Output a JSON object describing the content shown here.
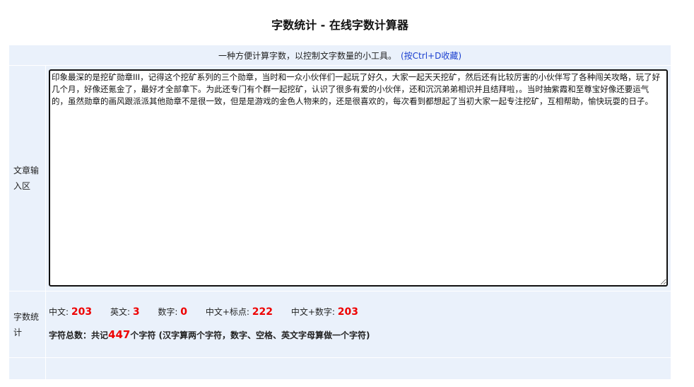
{
  "title": "字数统计 - 在线字数计算器",
  "intro": {
    "text": "一种方便计算字数，以控制文字数量的小工具。",
    "bookmark_link": "(按Ctrl+D收藏)"
  },
  "input_section": {
    "label": "文章输入区",
    "text": "印象最深的是挖矿勋章III，记得这个挖矿系列的三个勋章，当时和一众小伙伴们一起玩了好久，大家一起天天挖矿，然后还有比较厉害的小伙伴写了各种闯关攻略，玩了好几个月，好像还氪金了，最好才全部拿下。为此还专门有个群一起挖矿，认识了很多有爱的小伙伴，还和沉沉弟弟相识并且结拜啦，。当时抽紫霞和至尊宝好像还要运气的，虽然勋章的画风跟派派其他勋章不是很一致，但是是游戏的金色人物来的，还是很喜欢的，每次看到都想起了当初大家一起专注挖矿，互相帮助，愉快玩耍的日子。"
  },
  "stats_section": {
    "label": "字数统计",
    "chinese_label": "中文:",
    "chinese_value": "203",
    "english_label": "英文:",
    "english_value": "3",
    "digits_label": "数字:",
    "digits_value": "0",
    "chinese_punct_label": "中文+标点:",
    "chinese_punct_value": "222",
    "chinese_digits_label": "中文+数字:",
    "chinese_digits_value": "203",
    "total_prefix": "字符总数：共记",
    "total_value": "447",
    "total_suffix": "个字符 (汉字算两个字符，数字、空格、英文字母算做一个字符)"
  },
  "colors": {
    "panel_bg": "#eaf1fb",
    "highlight_number": "#ee0000",
    "link": "#1a3fcf"
  }
}
